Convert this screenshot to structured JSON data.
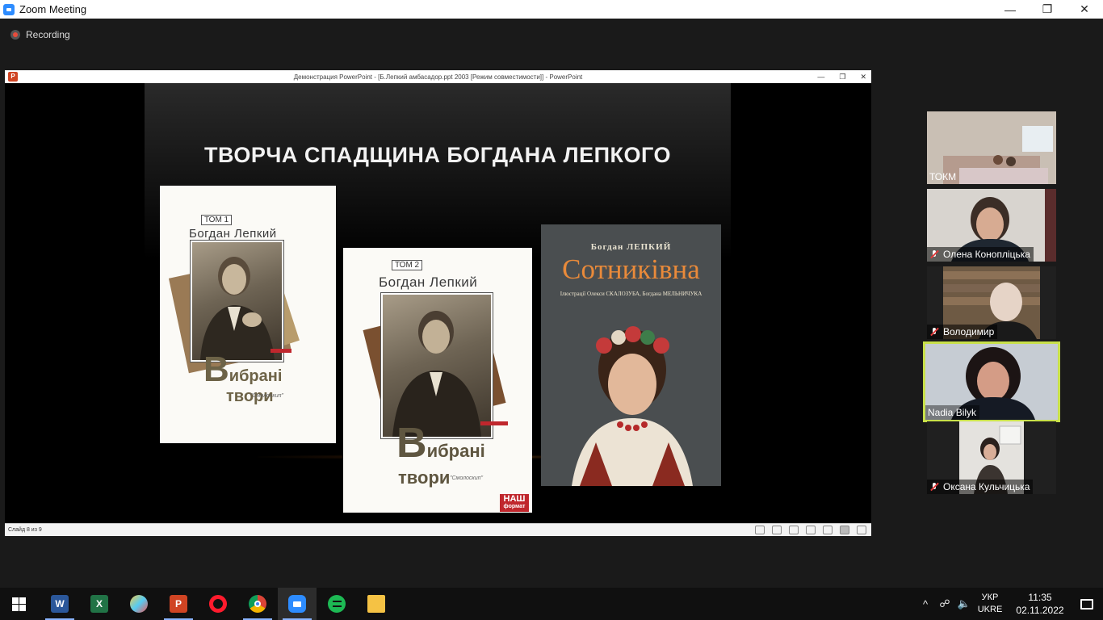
{
  "window": {
    "title": "Zoom Meeting"
  },
  "recording": {
    "label": "Recording"
  },
  "ppt": {
    "title": "Демонстрация PowerPoint - [Б.Лепкий амбасадор.ppt 2003 [Режим совместимости]] - PowerPoint",
    "slide_status": "Слайд 8 из 9",
    "slide": {
      "heading": "ТВОРЧА СПАДЩИНА БОГДАНА ЛЕПКОГО",
      "book1": {
        "volume": "ТОМ 1",
        "author": "Богдан Лепкий",
        "title_big": "В",
        "title_rest": "ибрані",
        "title_line2": "твори",
        "publisher": "\"Смолоскип\""
      },
      "book2": {
        "volume": "ТОМ 2",
        "author": "Богдан Лепкий",
        "title_big": "В",
        "title_rest": "ибрані",
        "title_line2": "твори",
        "publisher": "\"Смолоскип\"",
        "badge_line1": "НАШ",
        "badge_line2": "формат"
      },
      "book3": {
        "author": "Богдан ЛЕПКИЙ",
        "title": "Сотниківна",
        "illustrators": "Ілюстрації Олекси СКАЛОЗУБА, Богдана МЕЛЬНИЧУКА"
      }
    }
  },
  "participants": [
    {
      "name": "ТОКМ",
      "muted": false,
      "active": false
    },
    {
      "name": "Олена Коноплiцька",
      "muted": true,
      "active": false
    },
    {
      "name": "Володимир",
      "muted": true,
      "active": false
    },
    {
      "name": "Nadia Bilyk",
      "muted": false,
      "active": true
    },
    {
      "name": "Оксана Кульчицька",
      "muted": true,
      "active": false
    }
  ],
  "taskbar": {
    "lang_line1": "УКР",
    "lang_line2": "UKRE",
    "time": "11:35",
    "date": "02.11.2022",
    "apps": [
      "Word",
      "Excel",
      "Paint",
      "PowerPoint",
      "Opera",
      "Chrome",
      "Zoom",
      "Spotify",
      "File Explorer"
    ]
  },
  "colors": {
    "active_speaker_border": "#c8e04a",
    "zoom_blue": "#2d8cff",
    "book_title_orange": "#e98a3a",
    "red_bar": "#c0272d"
  }
}
